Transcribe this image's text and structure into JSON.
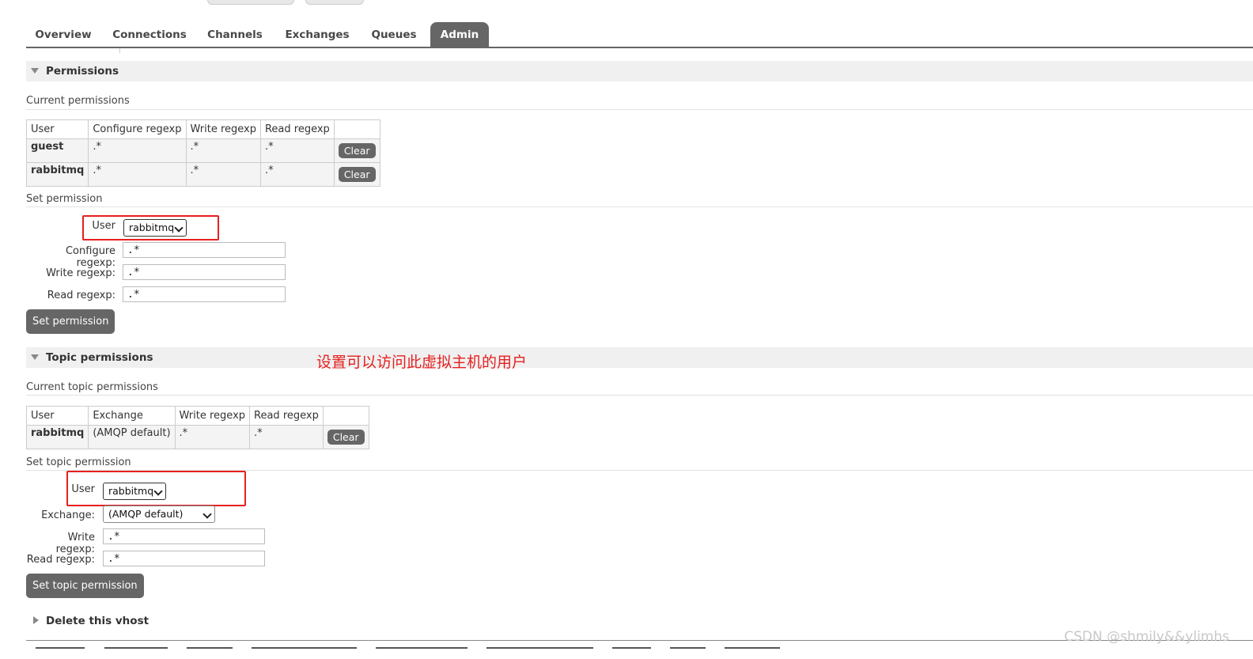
{
  "nav": {
    "tabs": [
      "Overview",
      "Connections",
      "Channels",
      "Exchanges",
      "Queues",
      "Admin"
    ],
    "active": "Admin"
  },
  "permissions": {
    "section_title": "Permissions",
    "current_title": "Current permissions",
    "columns": [
      "User",
      "Configure regexp",
      "Write regexp",
      "Read regexp",
      ""
    ],
    "rows": [
      {
        "user": "guest",
        "configure": ".*",
        "write": ".*",
        "read": ".*",
        "action": "Clear"
      },
      {
        "user": "rabbitmq",
        "configure": ".*",
        "write": ".*",
        "read": ".*",
        "action": "Clear"
      }
    ],
    "set_title": "Set permission",
    "form": {
      "user_label": "User",
      "user_value": "rabbitmq",
      "configure_label": "Configure regexp:",
      "configure_value": ".*",
      "write_label": "Write regexp:",
      "write_value": ".*",
      "read_label": "Read regexp:",
      "read_value": ".*",
      "submit": "Set permission"
    }
  },
  "topic_permissions": {
    "section_title": "Topic permissions",
    "current_title": "Current topic permissions",
    "columns": [
      "User",
      "Exchange",
      "Write regexp",
      "Read regexp",
      ""
    ],
    "rows": [
      {
        "user": "rabbitmq",
        "exchange": "(AMQP default)",
        "write": ".*",
        "read": ".*",
        "action": "Clear"
      }
    ],
    "set_title": "Set topic permission",
    "form": {
      "user_label": "User",
      "user_value": "rabbitmq",
      "exchange_label": "Exchange:",
      "exchange_value": "(AMQP default)",
      "write_label": "Write regexp:",
      "write_value": ".*",
      "read_label": "Read regexp:",
      "read_value": ".*",
      "submit": "Set topic permission"
    }
  },
  "delete_section": {
    "title": "Delete this vhost"
  },
  "annotation": "设置可以访问此虚拟主机的用户",
  "watermark": "CSDN @shmily&&ylimhs",
  "colors": {
    "tab_active": "#666666",
    "button": "#666666",
    "annotation_red": "#e62020"
  }
}
